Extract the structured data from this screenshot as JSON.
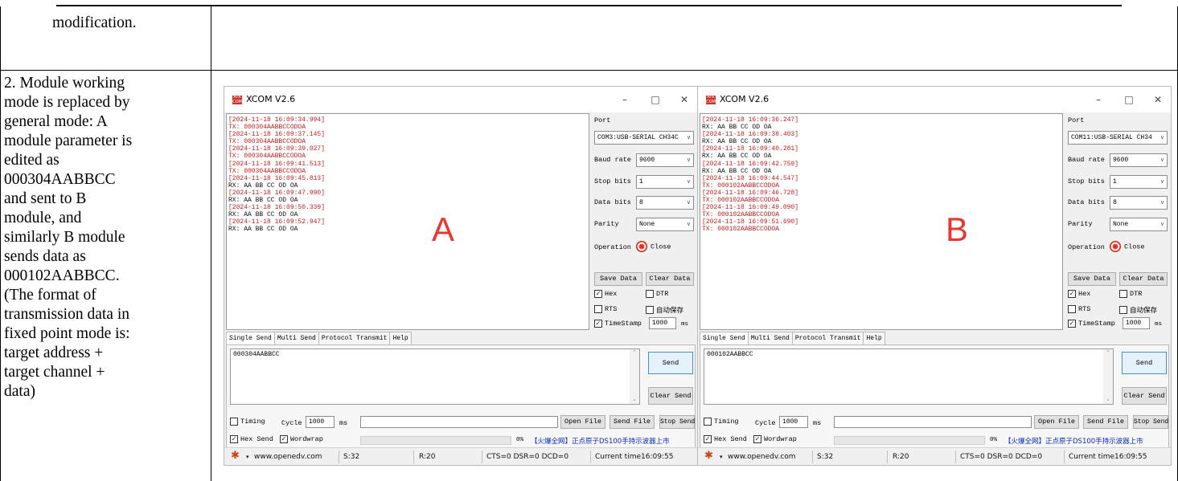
{
  "cells": {
    "top_left_text": "modification.",
    "description_lines": [
      "2. Module working",
      "mode is replaced by",
      "general mode: A",
      "module parameter is",
      "edited as",
      "000304AABBCC",
      "and sent to B",
      "module, and",
      "similarly B module",
      "sends data as",
      "000102AABBCC.",
      "(The format of",
      "transmission data in",
      "fixed point mode is:",
      "target address +",
      "target channel +",
      "data)"
    ]
  },
  "windows": [
    {
      "title": "XCOM V2.6",
      "icon_text": "ATK COM",
      "big_label": "A",
      "receive_lines": [
        {
          "kind": "ts",
          "text": "[2024-11-18 16:09:34.994]"
        },
        {
          "kind": "tx",
          "text": "TX: 000304AABBCCODOA"
        },
        {
          "kind": "ts",
          "text": "[2024-11-18 16:09:37.145]"
        },
        {
          "kind": "tx",
          "text": "TX: 000304AABBCCODOA"
        },
        {
          "kind": "ts",
          "text": "[2024-11-18 16:09:39.027]"
        },
        {
          "kind": "tx",
          "text": "TX: 000304AABBCCODOA"
        },
        {
          "kind": "ts",
          "text": "[2024-11-18 16:09:41.513]"
        },
        {
          "kind": "tx",
          "text": "TX: 000304AABBCCODOA"
        },
        {
          "kind": "ts",
          "text": "[2024-11-18 16:09:45.813]"
        },
        {
          "kind": "rx",
          "text": "RX: AA BB CC OD OA"
        },
        {
          "kind": "ts",
          "text": "[2024-11-18 16:09:47.990]"
        },
        {
          "kind": "rx",
          "text": "RX: AA BB CC OD OA"
        },
        {
          "kind": "ts",
          "text": "[2024-11-18 16:09:50.339]"
        },
        {
          "kind": "rx",
          "text": "RX: AA BB CC OD OA"
        },
        {
          "kind": "ts",
          "text": "[2024-11-18 16:09:52.947]"
        },
        {
          "kind": "rx",
          "text": "RX: AA BB CC OD OA"
        }
      ],
      "port_label": "Port",
      "port_value": "COM3:USB-SERIAL CH34C",
      "baud_label": "Baud rate",
      "baud_value": "9600",
      "stop_label": "Stop bits",
      "stop_value": "1",
      "data_label": "Data bits",
      "data_value": "8",
      "parity_label": "Parity",
      "parity_value": "None",
      "operation_label": "Operation",
      "close_label": "Close",
      "save_data": "Save Data",
      "clear_data": "Clear Data",
      "hex": "Hex",
      "dtr": "DTR",
      "rts": "RTS",
      "autosave": "自动保存",
      "timestamp": "TimeStamp",
      "timestamp_value": "1000",
      "ms": "ms",
      "tabs": [
        "Single Send",
        "Multi Send",
        "Protocol Transmit",
        "Help"
      ],
      "send_text": "000304AABBCC",
      "send_btn": "Send",
      "clear_send": "Clear Send",
      "timing": "Timing",
      "cycle": "Cycle",
      "cycle_value": "1000",
      "cycle_ms": "ms",
      "open_file": "Open File",
      "send_file": "Send File",
      "stop_send": "Stop Send",
      "hex_send": "Hex Send",
      "wordwrap": "Wordwrap",
      "percent": "0%",
      "promo": "【火爆全网】正点原子DS100手持示波器上市",
      "status": {
        "url": "www.openedv.com",
        "s": "S:32",
        "r": "R:20",
        "lines": "CTS=0 DSR=0 DCD=0",
        "time": "Current time16:09:55"
      }
    },
    {
      "title": "XCOM V2.6",
      "icon_text": "ATK COM",
      "big_label": "B",
      "receive_lines": [
        {
          "kind": "ts",
          "text": "[2024-11-18 16:09:36.247]"
        },
        {
          "kind": "rx",
          "text": "RX: AA BB CC OD OA"
        },
        {
          "kind": "ts",
          "text": "[2024-11-18 16:09:38.403]"
        },
        {
          "kind": "rx",
          "text": "RX: AA BB CC OD OA"
        },
        {
          "kind": "ts",
          "text": "[2024-11-18 16:09:40.281]"
        },
        {
          "kind": "rx",
          "text": "RX: AA BB CC OD OA"
        },
        {
          "kind": "ts",
          "text": "[2024-11-18 16:09:42.759]"
        },
        {
          "kind": "rx",
          "text": "RX: AA BB CC OD OA"
        },
        {
          "kind": "ts",
          "text": "[2024-11-18 16:09:44.547]"
        },
        {
          "kind": "tx",
          "text": "TX: 000102AABBCCODOA"
        },
        {
          "kind": "ts",
          "text": "[2024-11-18 16:09:46.728]"
        },
        {
          "kind": "tx",
          "text": "TX: 000102AABBCCODOA"
        },
        {
          "kind": "ts",
          "text": "[2024-11-18 16:09:49.090]"
        },
        {
          "kind": "tx",
          "text": "TX: 000102AABBCCODOA"
        },
        {
          "kind": "ts",
          "text": "[2024-11-18 16:09:51.690]"
        },
        {
          "kind": "tx",
          "text": "TX: 000102AABBCCODOA"
        }
      ],
      "port_label": "Port",
      "port_value": "COM11:USB-SERIAL CH34",
      "baud_label": "Baud rate",
      "baud_value": "9600",
      "stop_label": "Stop bits",
      "stop_value": "1",
      "data_label": "Data bits",
      "data_value": "8",
      "parity_label": "Parity",
      "parity_value": "None",
      "operation_label": "Operation",
      "close_label": "Close",
      "save_data": "Save Data",
      "clear_data": "Clear Data",
      "hex": "Hex",
      "dtr": "DTR",
      "rts": "RTS",
      "autosave": "自动保存",
      "timestamp": "TimeStamp",
      "timestamp_value": "1000",
      "ms": "ms",
      "tabs": [
        "Single Send",
        "Multi Send",
        "Protocol Transmit",
        "Help"
      ],
      "send_text": "000102AABBCC",
      "send_btn": "Send",
      "clear_send": "Clear Send",
      "timing": "Timing",
      "cycle": "Cycle",
      "cycle_value": "1000",
      "cycle_ms": "ms",
      "open_file": "Open File",
      "send_file": "Send File",
      "stop_send": "Stop Send",
      "hex_send": "Hex Send",
      "wordwrap": "Wordwrap",
      "percent": "0%",
      "promo": "【火爆全网】正点原子DS100手持示波器上市",
      "status": {
        "url": "www.openedv.com",
        "s": "S:32",
        "r": "R:20",
        "lines": "CTS=0 DSR=0 DCD=0",
        "time": "Current time16:09:55"
      }
    }
  ]
}
